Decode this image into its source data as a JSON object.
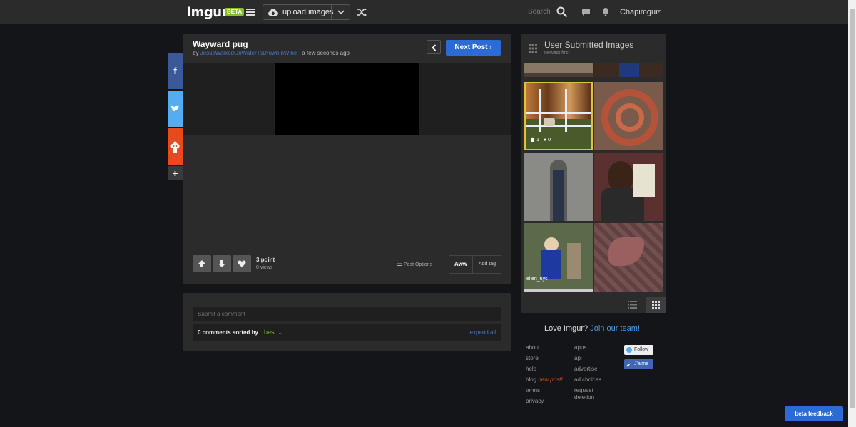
{
  "header": {
    "logo": "imgur",
    "beta_badge": "BETA",
    "upload_label": "upload images",
    "search_label": "Search",
    "username": "Chapimgur"
  },
  "post": {
    "title": "Wayward pug",
    "by_prefix": "by",
    "author": "JesusWalkedOnWaterToDrownInWine",
    "time": "· a few seconds ago",
    "next_label": "Next Post",
    "points": "3 point",
    "views": "0 views",
    "options_label": "Post Options",
    "tag": "Aww",
    "add_tag_label": "Add tag"
  },
  "comments": {
    "placeholder": "Submit a comment",
    "count_label": "0 comments sorted by",
    "sort": "best",
    "expand_label": "expand all"
  },
  "gallery": {
    "title": "User Submitted Images",
    "subtitle": "newest first",
    "selected_stats": {
      "upvotes": "1",
      "comments": "0"
    },
    "thumb_caption": "ellen_nyc"
  },
  "footer": {
    "love_prefix": "Love Imgur?",
    "join_label": "Join our team!",
    "col1": [
      "about",
      "store",
      "help",
      "blog",
      "terms",
      "privacy"
    ],
    "new_post_label": "new post!",
    "col2": [
      "apps",
      "api",
      "advertise",
      "ad choices",
      "request",
      "deletion"
    ],
    "follow_label": "Follow",
    "like_label": "J'aime"
  },
  "beta_feedback_label": "beta feedback",
  "colors": {
    "accent_blue": "#2c6bd6",
    "accent_green": "#85bf25",
    "background": "#141518",
    "panel": "#2b2b2b"
  }
}
